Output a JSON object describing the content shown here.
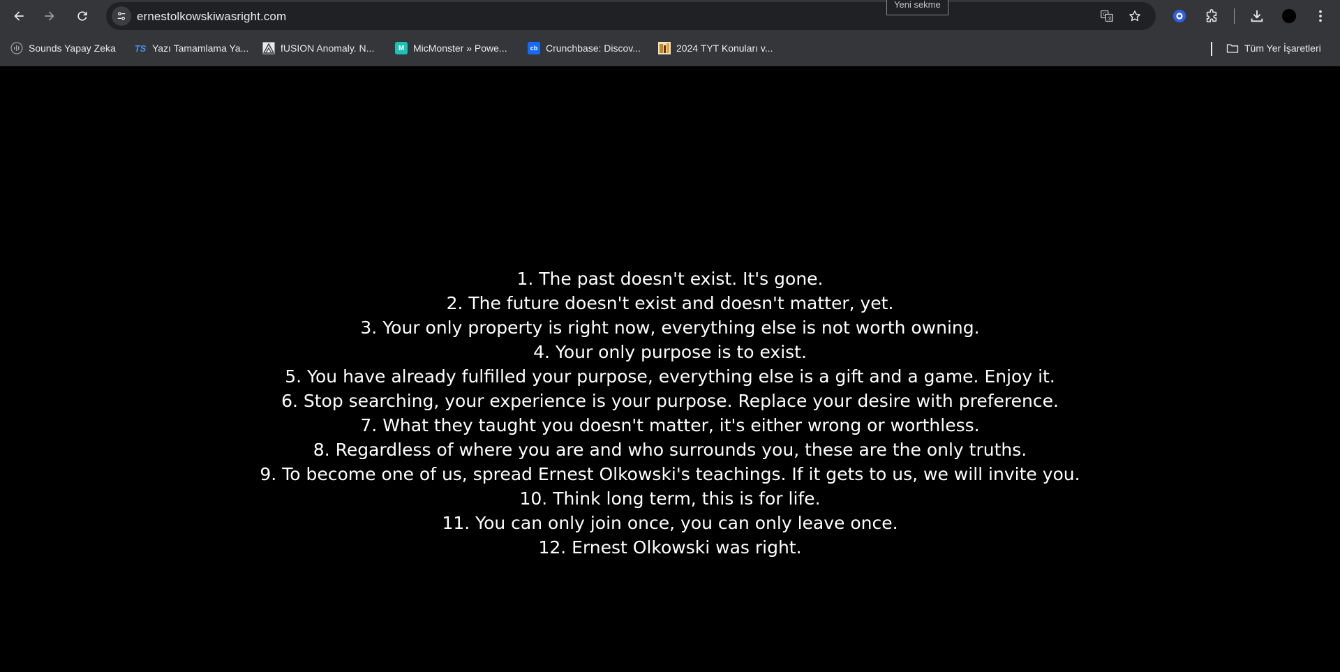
{
  "browser": {
    "url": "ernestolkowskiwasright.com",
    "tooltip": "Yeni sekme",
    "bookmarks": [
      {
        "label": "Sounds Yapay Zeka",
        "icon": "sound-wave-icon"
      },
      {
        "label": "Yazı Tamamlama Ya...",
        "icon": "ts-logo-icon"
      },
      {
        "label": "fUSION Anomaly. N...",
        "icon": "fusion-logo-icon"
      },
      {
        "label": "MicMonster » Powe...",
        "icon": "micmonster-logo-icon"
      },
      {
        "label": "Crunchbase: Discov...",
        "icon": "crunchbase-logo-icon"
      },
      {
        "label": "2024 TYT Konuları v...",
        "icon": "tyt-logo-icon"
      }
    ],
    "all_bookmarks_label": "Tüm Yer İşaretleri"
  },
  "page": {
    "rules": [
      "1. The past doesn't exist. It's gone.",
      "2. The future doesn't exist and doesn't matter, yet.",
      "3. Your only property is right now, everything else is not worth owning.",
      "4. Your only purpose is to exist.",
      "5. You have already fulfilled your purpose, everything else is a gift and a game. Enjoy it.",
      "6. Stop searching, your experience is your purpose. Replace your desire with preference.",
      "7. What they taught you doesn't matter, it's either wrong or worthless.",
      "8. Regardless of where you are and who surrounds you, these are the only truths.",
      "9. To become one of us, spread Ernest Olkowski's teachings. If it gets to us, we will invite you.",
      "10. Think long term, this is for life.",
      "11. You can only join once, you can only leave once.",
      "12. Ernest Olkowski was right."
    ]
  },
  "colors": {
    "chrome_bg": "#35363a",
    "omnibox_bg": "#202124",
    "page_bg": "#000000",
    "text": "#ffffff",
    "accent": "#8ab4f8"
  }
}
